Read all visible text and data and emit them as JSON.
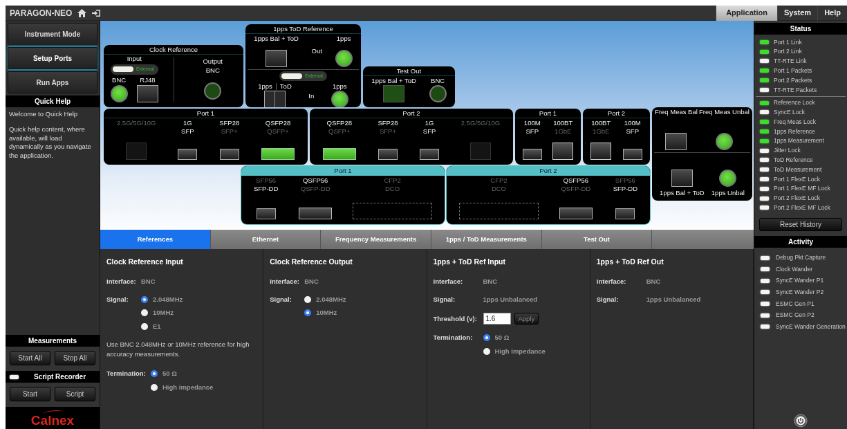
{
  "app_title": "PARAGON-NEO",
  "menu": [
    {
      "label": "Application",
      "selected": true
    },
    {
      "label": "System",
      "selected": false
    },
    {
      "label": "Help",
      "selected": false
    }
  ],
  "nav_buttons": [
    {
      "label": "Instrument Mode",
      "selected": false
    },
    {
      "label": "Setup Ports",
      "selected": true
    },
    {
      "label": "Run Apps",
      "selected": false
    }
  ],
  "quick_help": {
    "title": "Quick Help",
    "heading": "Welcome to Quick Help",
    "text": "Quick help content, where available, will load dynamically as you navigate the application."
  },
  "measurements": {
    "title": "Measurements",
    "buttons": [
      "Start All",
      "Stop All"
    ]
  },
  "script_recorder": {
    "title": "Script Recorder",
    "recording": false,
    "buttons": [
      "Start",
      "Script"
    ]
  },
  "logo": "Calnex",
  "diagram": {
    "panels": [
      {
        "title": "Clock Reference",
        "highlighted": false,
        "sections": [
          {
            "heading": "Input",
            "toggle": {
              "label": "External",
              "on": true
            },
            "columns": [
              {
                "labels": [
                  {
                    "text": "BNC",
                    "disabled": false
                  }
                ],
                "connector": {
                  "kind": "circle",
                  "active": true,
                  "disabled": false
                }
              },
              {
                "labels": [
                  {
                    "text": "RJ48",
                    "disabled": false
                  }
                ],
                "connector": {
                  "kind": "square",
                  "active": false,
                  "disabled": false
                }
              }
            ]
          },
          {
            "heading": "Output",
            "columns": [
              {
                "labels": [
                  {
                    "text": "BNC",
                    "disabled": false
                  }
                ],
                "connector": {
                  "kind": "circle",
                  "active": false,
                  "disabled": false
                }
              }
            ]
          }
        ]
      },
      {
        "title": "1pps ToD Reference",
        "highlighted": false,
        "sections": [
          {
            "columns": [
              {
                "labels": [
                  {
                    "text": "1pps Bal + ToD",
                    "disabled": false
                  }
                ],
                "connector": {
                  "kind": "square",
                  "active": false,
                  "disabled": false
                }
              },
              {
                "labels": [
                  {
                    "text": "Out",
                    "disabled": false
                  }
                ]
              },
              {
                "labels": [
                  {
                    "text": "1pps",
                    "disabled": false
                  }
                ],
                "connector": {
                  "kind": "circle",
                  "active": true,
                  "disabled": false
                }
              }
            ]
          },
          {
            "toggle": {
              "label": "External",
              "on": true
            },
            "columns": [
              {
                "inline": true,
                "labels": [
                  {
                    "text": "1pps",
                    "disabled": false
                  },
                  {
                    "text": "ToD",
                    "disabled": false
                  }
                ],
                "connector": {
                  "kind": "split",
                  "active": false,
                  "disabled": false
                }
              },
              {
                "labels": [
                  {
                    "text": "In",
                    "disabled": false
                  }
                ]
              },
              {
                "labels": [
                  {
                    "text": "1pps",
                    "disabled": false
                  }
                ],
                "connector": {
                  "kind": "circle",
                  "active": true,
                  "disabled": false
                }
              }
            ]
          }
        ]
      },
      {
        "title": "Test Out",
        "highlighted": false,
        "sections": [
          {
            "columns": [
              {
                "labels": [
                  {
                    "text": "1pps Bal + ToD",
                    "disabled": false
                  }
                ],
                "connector": {
                  "kind": "square",
                  "active": true,
                  "disabled": false
                }
              },
              {
                "labels": [
                  {
                    "text": "BNC",
                    "disabled": false
                  }
                ],
                "connector": {
                  "kind": "circle",
                  "active": false,
                  "disabled": false
                }
              }
            ]
          }
        ]
      },
      {
        "title": "Port 1",
        "highlighted": false,
        "sections": [
          {
            "columns": [
              {
                "labels": [
                  {
                    "text": "2.5G/5G/10G",
                    "disabled": true
                  }
                ],
                "connector": {
                  "kind": "rj45",
                  "active": false,
                  "disabled": true
                }
              },
              {
                "labels": [
                  {
                    "text": "1G",
                    "disabled": false
                  },
                  {
                    "text": "SFP",
                    "disabled": false
                  }
                ],
                "connector": {
                  "kind": "sfp",
                  "active": false,
                  "disabled": false
                }
              },
              {
                "labels": [
                  {
                    "text": "SFP28",
                    "disabled": false
                  },
                  {
                    "text": "SFP+",
                    "disabled": true
                  }
                ],
                "connector": {
                  "kind": "sfp",
                  "active": false,
                  "disabled": false
                }
              },
              {
                "labels": [
                  {
                    "text": "QSFP28",
                    "disabled": false
                  },
                  {
                    "text": "QSFP+",
                    "disabled": true
                  }
                ],
                "connector": {
                  "kind": "qsfp",
                  "active": true,
                  "disabled": false
                }
              }
            ]
          }
        ]
      },
      {
        "title": "Port 2",
        "highlighted": false,
        "sections": [
          {
            "columns": [
              {
                "labels": [
                  {
                    "text": "QSFP28",
                    "disabled": false
                  },
                  {
                    "text": "QSFP+",
                    "disabled": true
                  }
                ],
                "connector": {
                  "kind": "qsfp",
                  "active": true,
                  "disabled": false
                }
              },
              {
                "labels": [
                  {
                    "text": "SFP28",
                    "disabled": false
                  },
                  {
                    "text": "SFP+",
                    "disabled": true
                  }
                ],
                "connector": {
                  "kind": "sfp",
                  "active": false,
                  "disabled": false
                }
              },
              {
                "labels": [
                  {
                    "text": "1G",
                    "disabled": false
                  },
                  {
                    "text": "SFP",
                    "disabled": false
                  }
                ],
                "connector": {
                  "kind": "sfp",
                  "active": false,
                  "disabled": false
                }
              },
              {
                "labels": [
                  {
                    "text": "2.5G/5G/10G",
                    "disabled": true
                  }
                ],
                "connector": {
                  "kind": "rj45",
                  "active": false,
                  "disabled": true
                }
              }
            ]
          }
        ]
      },
      {
        "title": "Port 1",
        "highlighted": false,
        "sections": [
          {
            "columns": [
              {
                "labels": [
                  {
                    "text": "100M",
                    "disabled": false
                  },
                  {
                    "text": "SFP",
                    "disabled": false
                  }
                ],
                "connector": {
                  "kind": "sfp",
                  "active": false,
                  "disabled": false
                }
              },
              {
                "labels": [
                  {
                    "text": "100BT",
                    "disabled": false
                  },
                  {
                    "text": "1GbE",
                    "disabled": true
                  }
                ],
                "connector": {
                  "kind": "rj45",
                  "active": false,
                  "disabled": false
                }
              }
            ]
          }
        ]
      },
      {
        "title": "Port 2",
        "highlighted": false,
        "sections": [
          {
            "columns": [
              {
                "labels": [
                  {
                    "text": "100BT",
                    "disabled": false
                  },
                  {
                    "text": "1GbE",
                    "disabled": true
                  }
                ],
                "connector": {
                  "kind": "rj45",
                  "active": false,
                  "disabled": false
                }
              },
              {
                "labels": [
                  {
                    "text": "100M",
                    "disabled": false
                  },
                  {
                    "text": "SFP",
                    "disabled": false
                  }
                ],
                "connector": {
                  "kind": "sfp",
                  "active": false,
                  "disabled": false
                }
              }
            ]
          }
        ]
      },
      {
        "sections": [
          {
            "columns": [
              {
                "labels": [
                  {
                    "text": "Freq Meas Bal",
                    "disabled": false
                  }
                ],
                "connector": {
                  "kind": "square",
                  "active": false,
                  "disabled": false
                }
              },
              {
                "labels": [
                  {
                    "text": "Freq Meas Unbal",
                    "disabled": false
                  }
                ],
                "connector": {
                  "kind": "circle",
                  "active": true,
                  "disabled": false
                }
              }
            ]
          },
          {
            "columns": [
              {
                "captions": [
                  {
                    "text": "1pps Bal + ToD",
                    "disabled": false
                  }
                ],
                "connector": {
                  "kind": "square",
                  "active": false,
                  "disabled": false
                }
              },
              {
                "captions": [
                  {
                    "text": "1pps Unbal",
                    "disabled": false
                  }
                ],
                "connector": {
                  "kind": "circle",
                  "active": true,
                  "disabled": false
                }
              }
            ]
          }
        ]
      },
      {
        "title": "Port 1",
        "highlighted": true,
        "sections": [
          {
            "columns": [
              {
                "labels": [
                  {
                    "text": "SFP56",
                    "disabled": true
                  },
                  {
                    "text": "SFP-DD",
                    "disabled": false
                  }
                ],
                "connector": {
                  "kind": "sfp",
                  "active": false,
                  "disabled": false
                }
              },
              {
                "labels": [
                  {
                    "text": "QSFP56",
                    "disabled": false
                  },
                  {
                    "text": "QSFP-DD",
                    "disabled": true
                  }
                ],
                "connector": {
                  "kind": "qsfp",
                  "active": false,
                  "disabled": false
                }
              },
              {
                "labels": [
                  {
                    "text": "CFP2",
                    "disabled": true
                  },
                  {
                    "text": "DCO",
                    "disabled": true
                  }
                ],
                "connector": {
                  "kind": "cfp",
                  "active": false,
                  "disabled": true
                }
              }
            ]
          }
        ]
      },
      {
        "title": "Port 2",
        "highlighted": true,
        "sections": [
          {
            "columns": [
              {
                "labels": [
                  {
                    "text": "CFP2",
                    "disabled": true
                  },
                  {
                    "text": "DCO",
                    "disabled": true
                  }
                ],
                "connector": {
                  "kind": "cfp",
                  "active": false,
                  "disabled": true
                }
              },
              {
                "labels": [
                  {
                    "text": "QSFP56",
                    "disabled": false
                  },
                  {
                    "text": "QSFP-DD",
                    "disabled": true
                  }
                ],
                "connector": {
                  "kind": "qsfp",
                  "active": false,
                  "disabled": false
                }
              },
              {
                "labels": [
                  {
                    "text": "SFP56",
                    "disabled": true
                  },
                  {
                    "text": "SFP-DD",
                    "disabled": false
                  }
                ],
                "connector": {
                  "kind": "sfp",
                  "active": false,
                  "disabled": false
                }
              }
            ]
          }
        ]
      }
    ]
  },
  "tabs": [
    {
      "label": "References",
      "selected": true
    },
    {
      "label": "Ethernet",
      "selected": false
    },
    {
      "label": "Frequency Measurements",
      "selected": false
    },
    {
      "label": "1pps / ToD Measurements",
      "selected": false
    },
    {
      "label": "Test Out",
      "selected": false
    }
  ],
  "settings": [
    {
      "title": "Clock Reference Input",
      "fields": [
        {
          "kind": "text",
          "label": "Interface:",
          "value": "BNC"
        },
        {
          "kind": "radio",
          "label": "Signal:",
          "options": [
            {
              "text": "2.048MHz",
              "selected": true
            },
            {
              "text": "10MHz",
              "selected": false
            },
            {
              "text": "E1",
              "selected": false
            }
          ]
        },
        {
          "kind": "note",
          "text": "Use BNC 2.048MHz or 10MHz reference for high accuracy measurements."
        },
        {
          "kind": "radio",
          "label": "Termination:",
          "options": [
            {
              "text": "50 Ω",
              "selected": true
            },
            {
              "text": "High impedance",
              "selected": false
            }
          ]
        }
      ]
    },
    {
      "title": "Clock Reference Output",
      "fields": [
        {
          "kind": "text",
          "label": "Interface:",
          "value": "BNC"
        },
        {
          "kind": "radio",
          "label": "Signal:",
          "options": [
            {
              "text": "2.048MHz",
              "selected": false
            },
            {
              "text": "10MHz",
              "selected": true
            }
          ]
        }
      ]
    },
    {
      "title": "1pps + ToD Ref Input",
      "fields": [
        {
          "kind": "text",
          "label": "Interface:",
          "value": "BNC"
        },
        {
          "kind": "text",
          "label": "Signal:",
          "value": "1pps Unbalanced"
        },
        {
          "kind": "input",
          "label": "Threshold (v):",
          "value": "1.6",
          "button": "Apply"
        },
        {
          "kind": "radio",
          "label": "Termination:",
          "options": [
            {
              "text": "50 Ω",
              "selected": true
            },
            {
              "text": "High impedance",
              "selected": false
            }
          ]
        }
      ]
    },
    {
      "title": "1pps + ToD Ref Out",
      "fields": [
        {
          "kind": "text",
          "label": "Interface:",
          "value": "BNC"
        },
        {
          "kind": "text",
          "label": "Signal:",
          "value": "1pps Unbalanced"
        }
      ]
    }
  ],
  "status": {
    "title": "Status",
    "groups": [
      [
        {
          "label": "Port 1 Link",
          "on": true
        },
        {
          "label": "Port 2 Link",
          "on": true
        },
        {
          "label": "TT-RTE Link",
          "on": false
        },
        {
          "label": "Port 1 Packets",
          "on": true
        },
        {
          "label": "Port 2 Packets",
          "on": true
        },
        {
          "label": "TT-RTE Packets",
          "on": false
        }
      ],
      [
        {
          "label": "Reference Lock",
          "on": true
        },
        {
          "label": "SyncE Lock",
          "on": false
        },
        {
          "label": "Freq Meas Lock",
          "on": true
        },
        {
          "label": "1pps Reference",
          "on": true
        },
        {
          "label": "1pps Measurement",
          "on": true
        },
        {
          "label": "Jitter Lock",
          "on": false
        },
        {
          "label": "ToD Reference",
          "on": false
        },
        {
          "label": "ToD Measurement",
          "on": false
        },
        {
          "label": "Port 1 FlexE Lock",
          "on": false
        },
        {
          "label": "Port 1 FlexE MF Lock",
          "on": false
        },
        {
          "label": "Port 2 FlexE Lock",
          "on": false
        },
        {
          "label": "Port 2 FlexE MF Lock",
          "on": false
        }
      ]
    ],
    "button": "Reset History"
  },
  "activity": {
    "title": "Activity",
    "items": [
      {
        "label": "Debug Pkt Capture",
        "on": false
      },
      {
        "label": "Clock Wander",
        "on": false
      },
      {
        "label": "SyncE Wander P1",
        "on": false
      },
      {
        "label": "SyncE Wander P2",
        "on": false
      },
      {
        "label": "ESMC Gen P1",
        "on": false
      },
      {
        "label": "ESMC Gen P2",
        "on": false
      },
      {
        "label": "SyncE Wander Generation",
        "on": false
      }
    ]
  }
}
